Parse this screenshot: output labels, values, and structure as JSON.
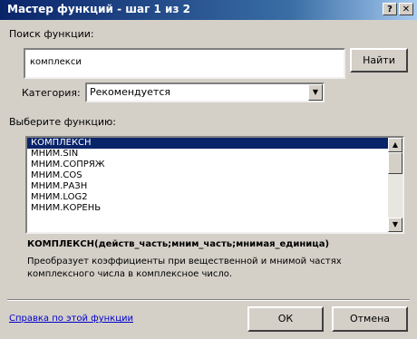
{
  "window": {
    "title": "Мастер функций - шаг 1 из 2",
    "help_glyph": "?",
    "close_glyph": "✕"
  },
  "search": {
    "label": "Поиск функции:",
    "value": "комплекси",
    "find_button": "Найти"
  },
  "category": {
    "label": "Категория:",
    "selected": "Рекомендуется",
    "arrow": "▼"
  },
  "function_list": {
    "label": "Выберите функцию:",
    "items": [
      "КОМПЛЕКСН",
      "МНИМ.SIN",
      "МНИМ.СОПРЯЖ",
      "МНИМ.COS",
      "МНИМ.РАЗН",
      "МНИМ.LOG2",
      "МНИМ.КОРЕНЬ"
    ],
    "selected_index": 0,
    "scroll_up": "▲",
    "scroll_down": "▼"
  },
  "details": {
    "signature": "КОМПЛЕКСН(действ_часть;мним_часть;мнимая_единица)",
    "description": "Преобразует коэффициенты при вещественной и мнимой частях комплексного числа в комплексное число."
  },
  "footer": {
    "help_link": "Справка по этой функции",
    "ok": "ОК",
    "cancel": "Отмена"
  }
}
